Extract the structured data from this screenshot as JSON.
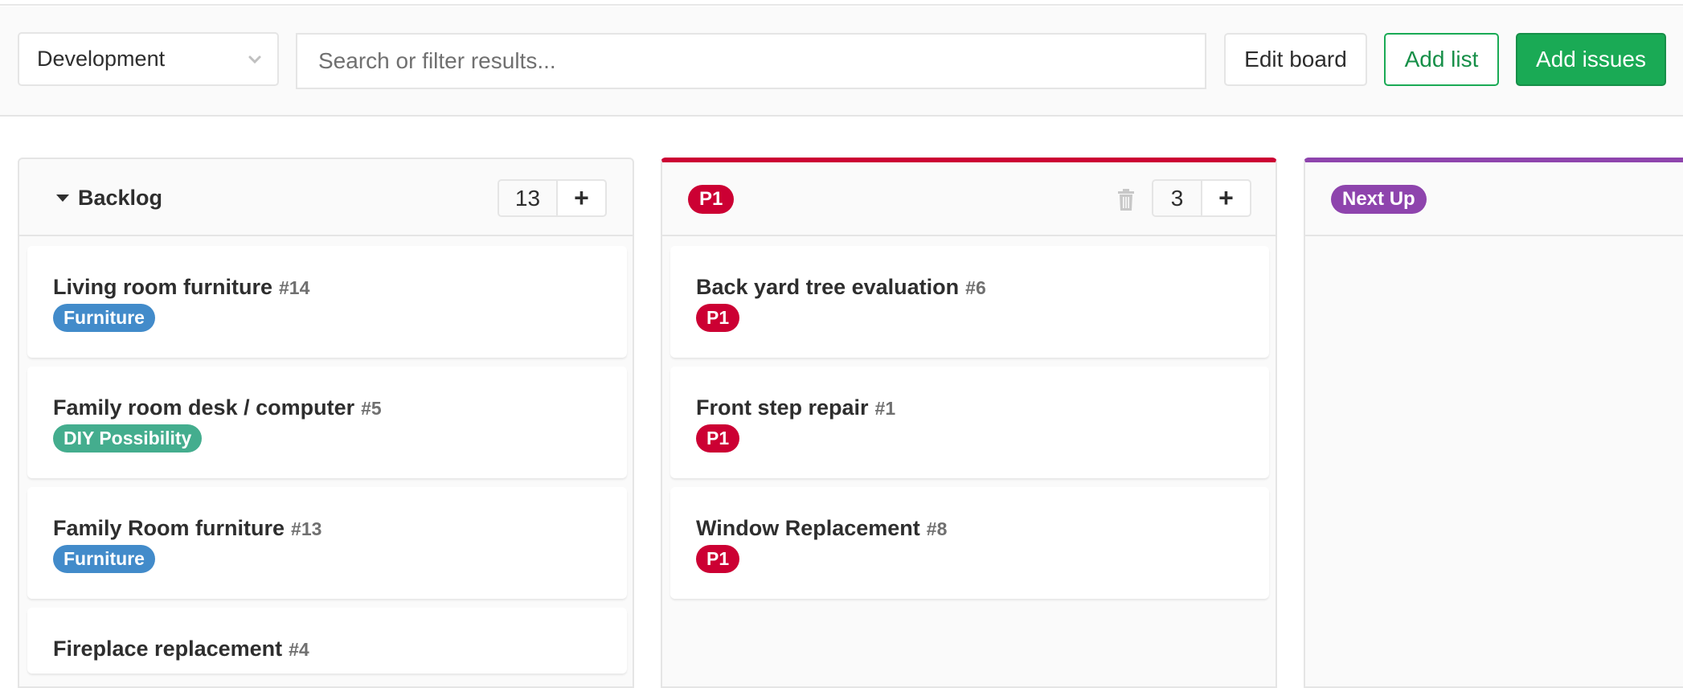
{
  "filters": {
    "board_select": {
      "value": "Development"
    },
    "search": {
      "placeholder": "Search or filter results...",
      "value": ""
    },
    "buttons": {
      "edit_board": "Edit board",
      "add_list": "Add list",
      "add_issues": "Add issues"
    }
  },
  "colors": {
    "success": "#1aaa55",
    "p1": "#cc0033",
    "next_up": "#8e44ad",
    "furniture": "#428bca",
    "diy": "#44ad8e"
  },
  "lists": [
    {
      "title": "Backlog",
      "count": "13",
      "add_icon": "+",
      "cards": [
        {
          "title": "Living room furniture",
          "ref": "#14",
          "label": "Furniture",
          "label_color": "#428bca"
        },
        {
          "title": "Family room desk / computer",
          "ref": "#5",
          "label": "DIY Possibility",
          "label_color": "#44ad8e"
        },
        {
          "title": "Family Room furniture",
          "ref": "#13",
          "label": "Furniture",
          "label_color": "#428bca"
        },
        {
          "title": "Fireplace replacement",
          "ref": "#4"
        }
      ]
    },
    {
      "title": "P1",
      "color": "#cc0033",
      "count": "3",
      "add_icon": "+",
      "cards": [
        {
          "title": "Back yard tree evaluation",
          "ref": "#6",
          "label": "P1",
          "label_color": "#cc0033"
        },
        {
          "title": "Front step repair",
          "ref": "#1",
          "label": "P1",
          "label_color": "#cc0033"
        },
        {
          "title": "Window Replacement",
          "ref": "#8",
          "label": "P1",
          "label_color": "#cc0033"
        }
      ]
    },
    {
      "title": "Next Up",
      "color": "#8e44ad",
      "cards": []
    }
  ]
}
